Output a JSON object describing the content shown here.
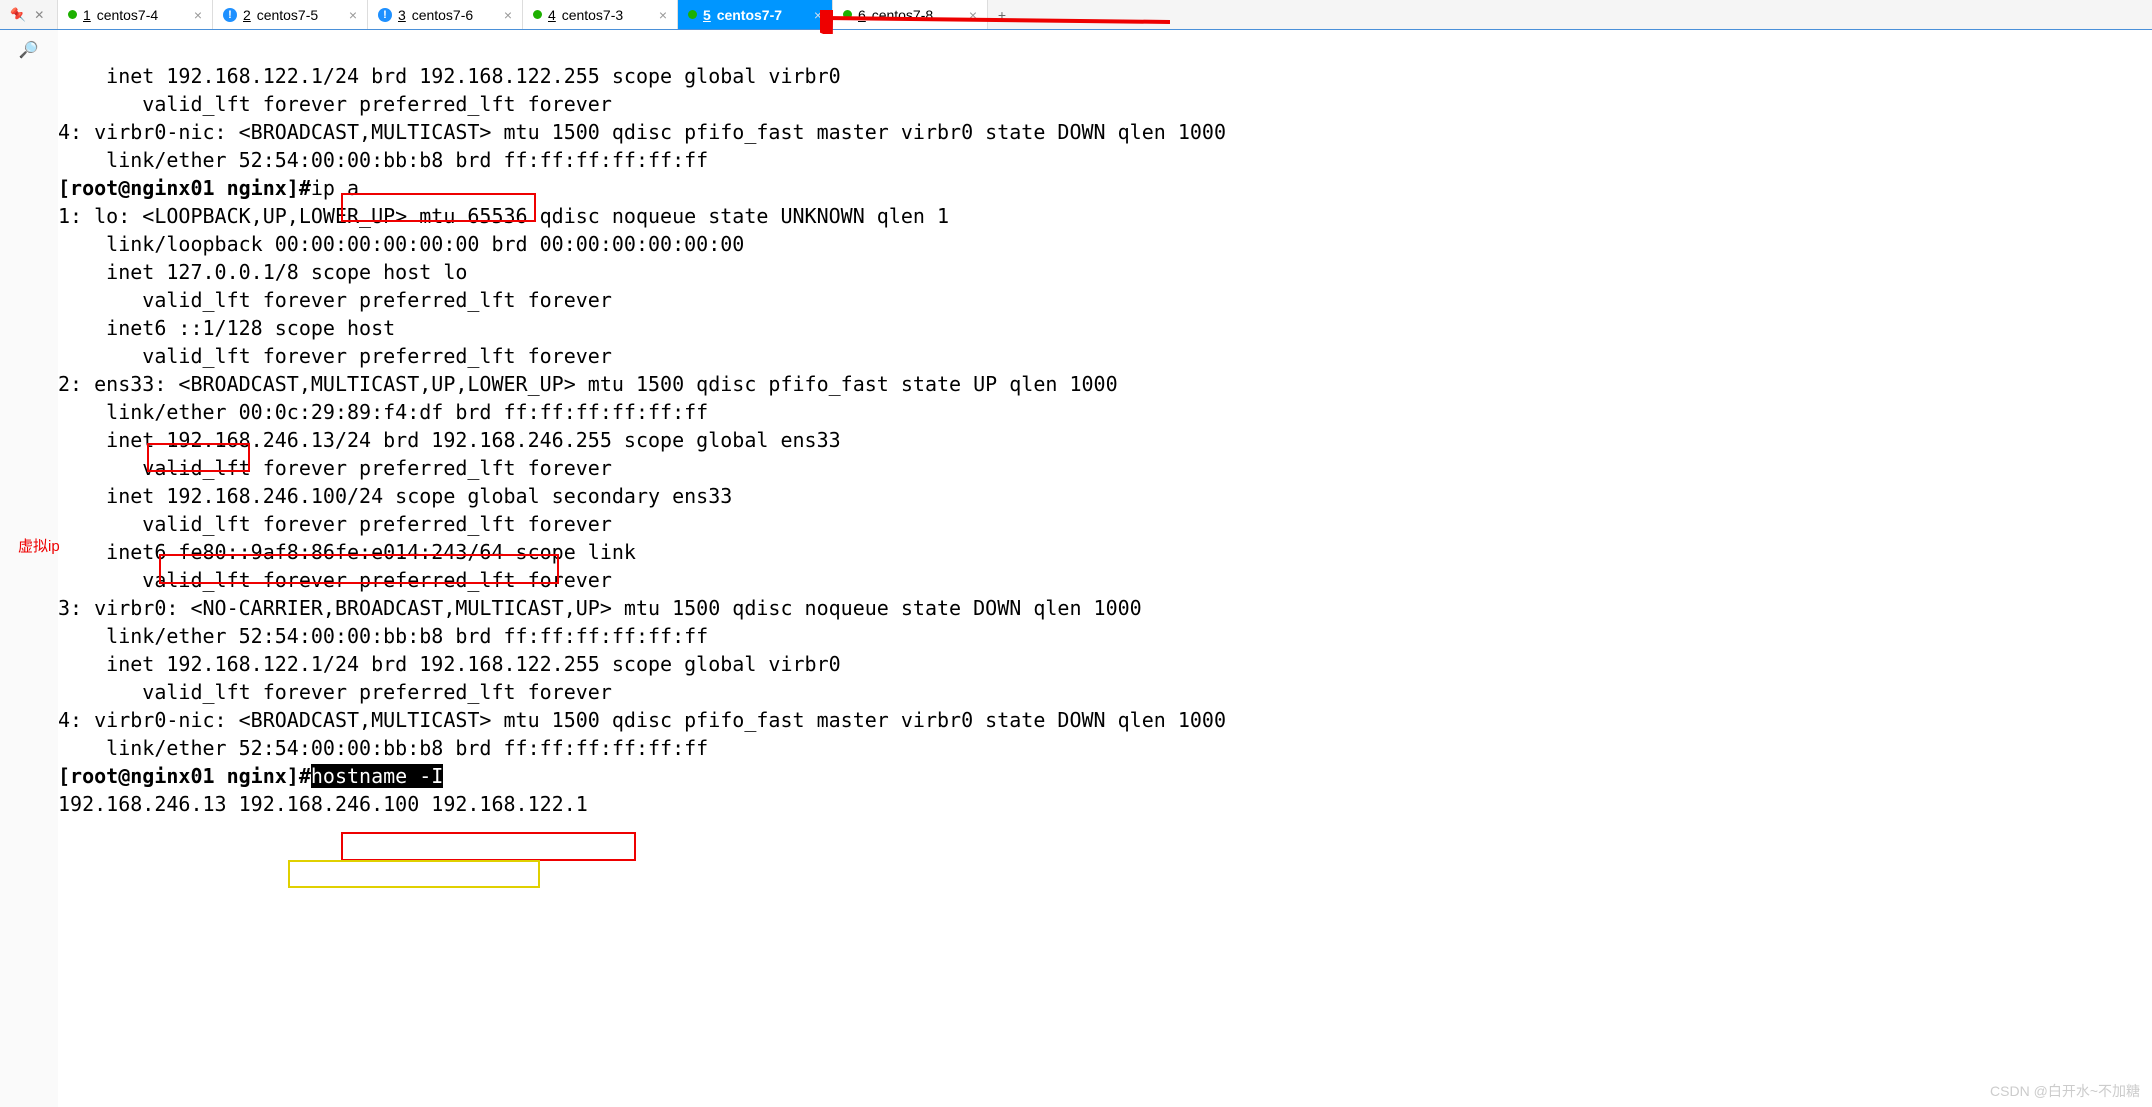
{
  "tabs": [
    {
      "num": "1",
      "label": "centos7-4",
      "icon": "green"
    },
    {
      "num": "2",
      "label": "centos7-5",
      "icon": "alert"
    },
    {
      "num": "3",
      "label": "centos7-6",
      "icon": "alert"
    },
    {
      "num": "4",
      "label": "centos7-3",
      "icon": "green"
    },
    {
      "num": "5",
      "label": "centos7-7",
      "icon": "green",
      "active": true
    },
    {
      "num": "6",
      "label": "centos7-8",
      "icon": "green"
    }
  ],
  "annotation_label": "虚拟ip",
  "watermark": "CSDN @白开水~不加糖",
  "lines": {
    "l0": "    inet 192.168.122.1/24 brd 192.168.122.255 scope global virbr0",
    "l1": "       valid_lft forever preferred_lft forever",
    "l2": "4: virbr0-nic: <BROADCAST,MULTICAST> mtu 1500 qdisc pfifo_fast master virbr0 state DOWN qlen 1000",
    "l3": "    link/ether 52:54:00:00:bb:b8 brd ff:ff:ff:ff:ff:ff",
    "prompt1_a": "[root@nginx01 nginx]#",
    "prompt1_b": "ip a",
    "l5": "1: lo: <LOOPBACK,UP,LOWER_UP> mtu 65536 qdisc noqueue state UNKNOWN qlen 1",
    "l6": "    link/loopback 00:00:00:00:00:00 brd 00:00:00:00:00:00",
    "l7": "    inet 127.0.0.1/8 scope host lo",
    "l8": "       valid_lft forever preferred_lft forever",
    "l9": "    inet6 ::1/128 scope host ",
    "l10": "       valid_lft forever preferred_lft forever",
    "l11": "2: ens33: <BROADCAST,MULTICAST,UP,LOWER_UP> mtu 1500 qdisc pfifo_fast state UP qlen 1000",
    "l12": "    link/ether 00:0c:29:89:f4:df brd ff:ff:ff:ff:ff:ff",
    "l13": "    inet 192.168.246.13/24 brd 192.168.246.255 scope global ens33",
    "l14": "       valid_lft forever preferred_lft forever",
    "l15": "    inet 192.168.246.100/24 scope global secondary ens33",
    "l16": "       valid_lft forever preferred_lft forever",
    "l17": "    inet6 fe80::9af8:86fe:e014:243/64 scope link ",
    "l18": "       valid_lft forever preferred_lft forever",
    "l19": "3: virbr0: <NO-CARRIER,BROADCAST,MULTICAST,UP> mtu 1500 qdisc noqueue state DOWN qlen 1000",
    "l20": "    link/ether 52:54:00:00:bb:b8 brd ff:ff:ff:ff:ff:ff",
    "l21": "    inet 192.168.122.1/24 brd 192.168.122.255 scope global virbr0",
    "l22": "       valid_lft forever preferred_lft forever",
    "l23": "4: virbr0-nic: <BROADCAST,MULTICAST> mtu 1500 qdisc pfifo_fast master virbr0 state DOWN qlen 1000",
    "l24": "    link/ether 52:54:00:00:bb:b8 brd ff:ff:ff:ff:ff:ff",
    "prompt2_a": "[root@nginx01 nginx]#",
    "prompt2_b": "hostname -I",
    "l26": "192.168.246.13 192.168.246.100 192.168.122.1 "
  }
}
